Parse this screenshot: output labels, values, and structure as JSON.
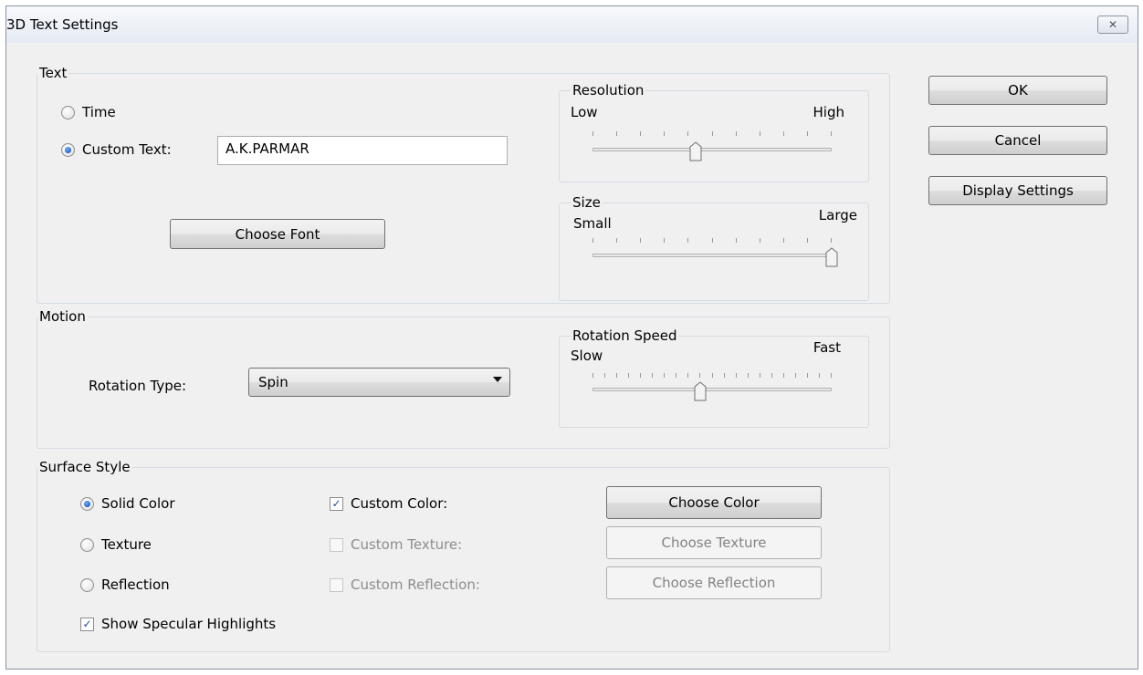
{
  "window": {
    "title": "3D Text Settings",
    "close_icon": "close-icon"
  },
  "text_group": {
    "label": "Text",
    "time_label": "Time",
    "custom_text_label": "Custom Text:",
    "custom_text_value": "A.K.PARMAR",
    "selected_option": "Custom Text",
    "choose_font_label": "Choose Font",
    "resolution": {
      "label": "Resolution",
      "low": "Low",
      "high": "High",
      "value": 0.43
    },
    "size": {
      "label": "Size",
      "low": "Small",
      "high": "Large",
      "value": 1.0
    }
  },
  "motion_group": {
    "label": "Motion",
    "rotation_type_label": "Rotation Type:",
    "rotation_type_value": "Spin",
    "rotation_speed": {
      "label": "Rotation Speed",
      "low": "Slow",
      "high": "Fast",
      "value": 0.45
    }
  },
  "surface_group": {
    "label": "Surface Style",
    "solid_color_label": "Solid Color",
    "texture_label": "Texture",
    "reflection_label": "Reflection",
    "selected_style": "Solid Color",
    "custom_color_label": "Custom Color:",
    "custom_color_checked": true,
    "custom_texture_label": "Custom Texture:",
    "custom_texture_checked": false,
    "custom_reflection_label": "Custom Reflection:",
    "custom_reflection_checked": false,
    "choose_color_label": "Choose Color",
    "choose_texture_label": "Choose Texture",
    "choose_reflection_label": "Choose Reflection",
    "specular_label": "Show Specular Highlights",
    "specular_checked": true
  },
  "buttons": {
    "ok": "OK",
    "cancel": "Cancel",
    "display_settings": "Display Settings"
  },
  "colors": {
    "window_bg": "#eef1f6",
    "client_bg": "#f0f0f0",
    "accent": "#1a56b8"
  }
}
